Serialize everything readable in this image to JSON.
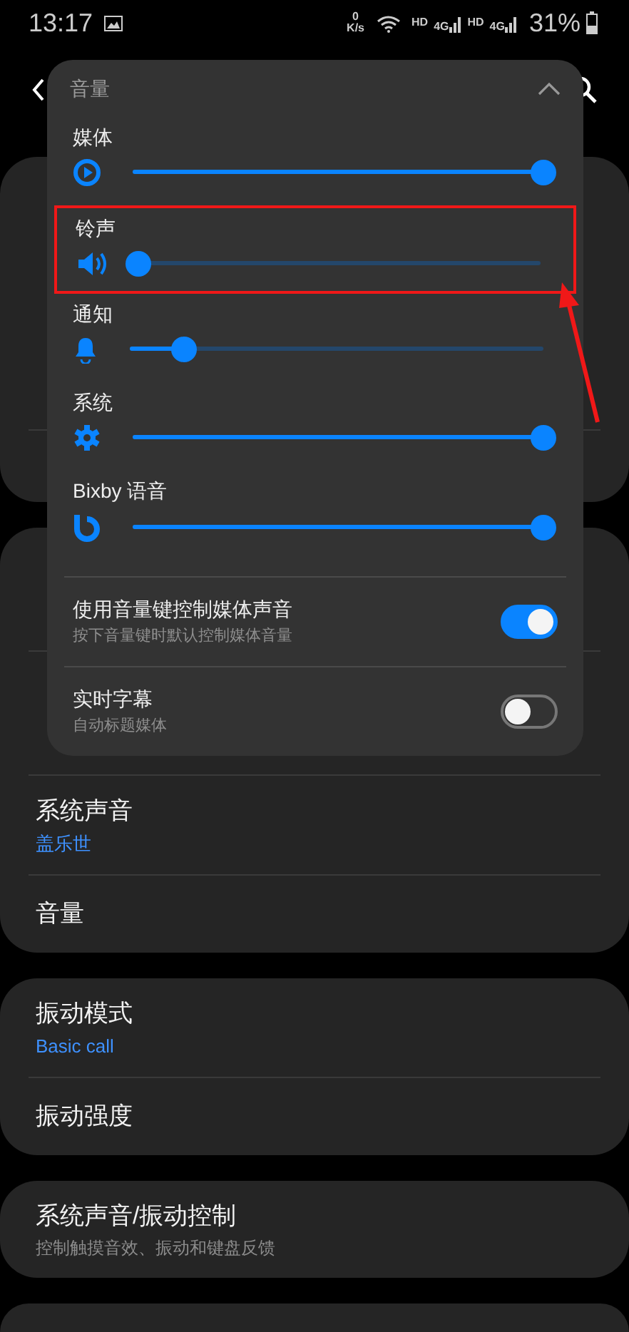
{
  "status_bar": {
    "time": "13:17",
    "speed_value": "0",
    "speed_unit": "K/s",
    "sims": [
      {
        "hd": "HD",
        "network": "4G"
      },
      {
        "hd": "HD",
        "network": "4G"
      }
    ],
    "battery": "31%"
  },
  "groups": [
    {
      "items": [
        {
          "title": "系统声音",
          "summary": "盖乐世"
        },
        {
          "title": "音量"
        }
      ]
    },
    {
      "items": [
        {
          "title": "振动模式",
          "summary": "Basic call"
        },
        {
          "title": "振动强度"
        }
      ]
    },
    {
      "items": [
        {
          "title": "系统声音/振动控制",
          "description": "控制触摸音效、振动和键盘反馈"
        }
      ]
    }
  ],
  "volume_panel": {
    "title": "音量",
    "expanded": true,
    "sliders": [
      {
        "label": "媒体",
        "kind": "media",
        "level": 1,
        "highlighted": false
      },
      {
        "label": "铃声",
        "kind": "ringtone",
        "level": 0,
        "highlighted": true
      },
      {
        "label": "通知",
        "kind": "notification",
        "level": 0.13,
        "highlighted": false
      },
      {
        "label": "系统",
        "kind": "system",
        "level": 1,
        "highlighted": false
      },
      {
        "label": "Bixby 语音",
        "kind": "bixby",
        "level": 1,
        "highlighted": false
      }
    ],
    "toggles": [
      {
        "title": "使用音量键控制媒体声音",
        "subtitle": "按下音量键时默认控制媒体音量",
        "on": true
      },
      {
        "title": "实时字幕",
        "subtitle": "自动标题媒体",
        "on": false
      }
    ]
  }
}
